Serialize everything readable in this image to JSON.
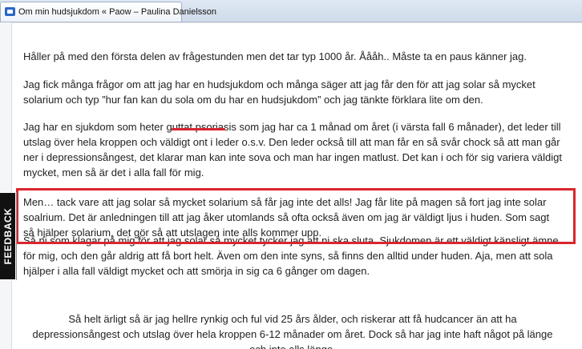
{
  "browser": {
    "tab_title": "Om min hudsjukdom « Paow – Paulina Danielsson",
    "tab_icon": "blog-favicon-icon"
  },
  "article": {
    "paragraphs": [
      "Håller på med den första delen av frågestunden men det tar typ 1000 år. Åååh.. Måste ta en paus känner jag.",
      "Jag fick många frågor om att jag har en hudsjukdom och många säger att jag får den för att jag solar så mycket solarium och typ ”hur fan kan du sola om du har en hudsjukdom” och jag tänkte förklara lite om den.",
      "Jag har en sjukdom som heter guttat psoriasis som jag har ca 1 månad om året (i värsta fall 6 månader), det leder till utslag över hela kroppen och väldigt ont i leder o.s.v. Den leder också till att man får en så svår chock så att man går ner i depressionsångest, det klarar man kan inte sova och man har ingen matlust. Det kan i och för sig variera väldigt mycket, men så är det i alla fall för mig.",
      "Men… tack vare att jag solar så mycket solarium så får jag inte det alls! Jag får lite på magen så fort jag inte solar soalrium. Det är anledningen till att jag åker utomlands så ofta också även om jag är väldigt ljus i huden. Som sagt så hjälper solarium, det gör så att utslagen inte alls kommer upp.",
      "Så ni som klagar på mig för att jag solar så mycket tycker jag att ni ska sluta. Sjukdomen är ett väldigt känsligt ämne för mig, och den går aldrig att få bort helt. Även om den inte syns, så finns den alltid under huden. Aja, men att sola hjälper i alla fall väldigt mycket och att smörja in sig ca 6 gånger om dagen.",
      "Så helt ärligt så är jag hellre rynkig och ful vid 25 års ålder, och riskerar att få hudcancer än att ha depressionsångest och utslag över hela kroppen 6-12 månader om året. Dock så har jag inte haft något på länge och inte alls länge."
    ]
  },
  "feedback": {
    "label": "FEEDBACK"
  },
  "annotations": {
    "highlight_color": "#d9262e"
  }
}
